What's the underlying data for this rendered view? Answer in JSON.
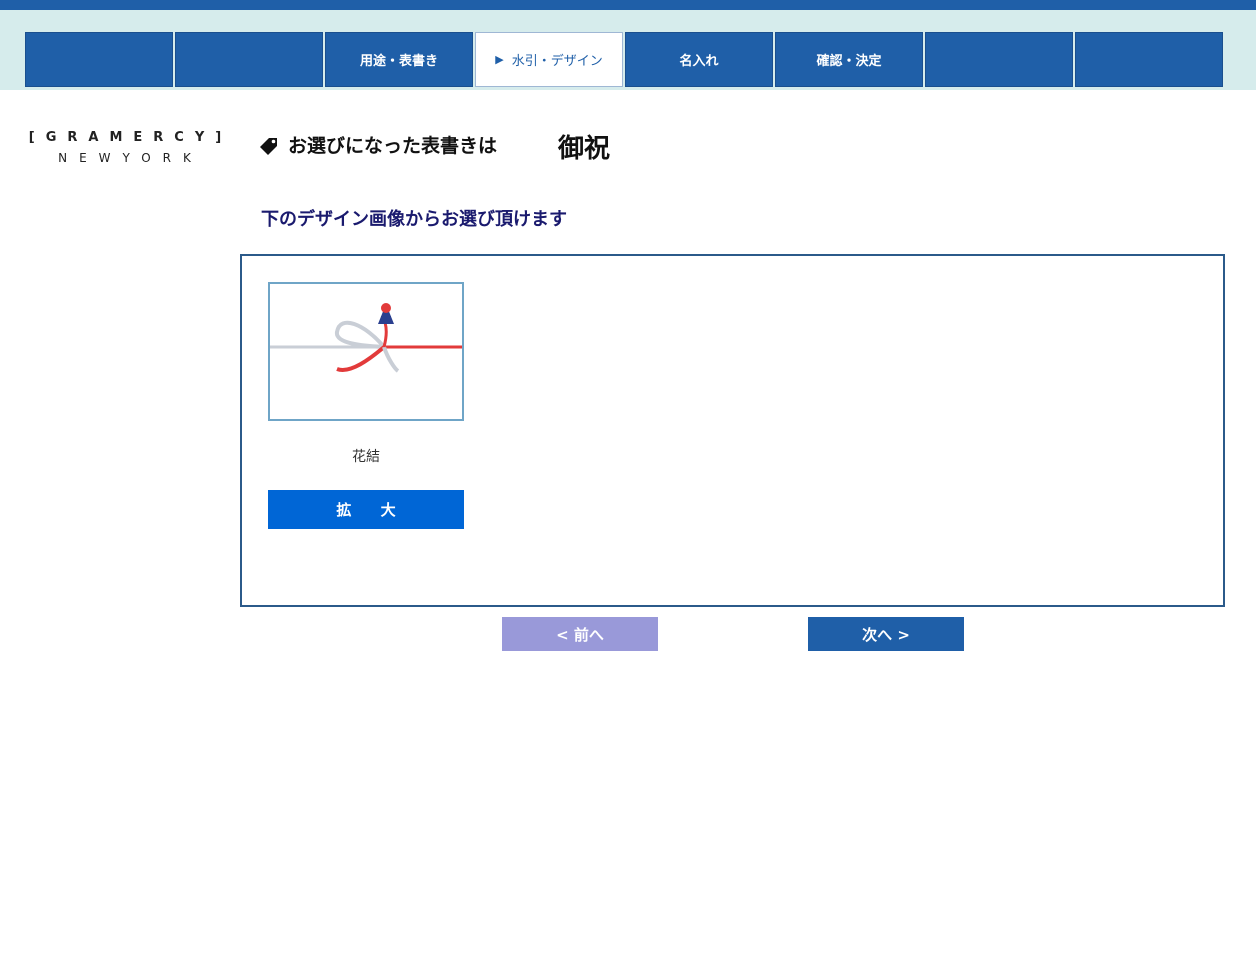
{
  "steps": [
    {
      "label": ""
    },
    {
      "label": ""
    },
    {
      "label": "用途・表書き"
    },
    {
      "label": "水引・デザイン",
      "active": true,
      "marker": "▶"
    },
    {
      "label": "名入れ"
    },
    {
      "label": "確認・決定"
    },
    {
      "label": ""
    },
    {
      "label": ""
    }
  ],
  "logo": {
    "line1": "[GRAMERCY]",
    "line2": "NEWYORK"
  },
  "selection": {
    "label": "お選びになった表書きは",
    "value": "御祝"
  },
  "instruction": "下のデザイン画像からお選び頂けます",
  "designs": [
    {
      "name": "花結",
      "zoom_label": "拡 大"
    }
  ],
  "nav": {
    "prev_label": "< 前へ",
    "next_label": "次へ >"
  },
  "colors": {
    "primary": "#1f5fa8",
    "band": "#d6ecec",
    "zoom": "#0066d6",
    "prev_disabled": "#9999d9",
    "instruction": "#1a1a6e"
  },
  "icons": {
    "tag": "tag-icon",
    "step_marker": "play-triangle-icon"
  }
}
